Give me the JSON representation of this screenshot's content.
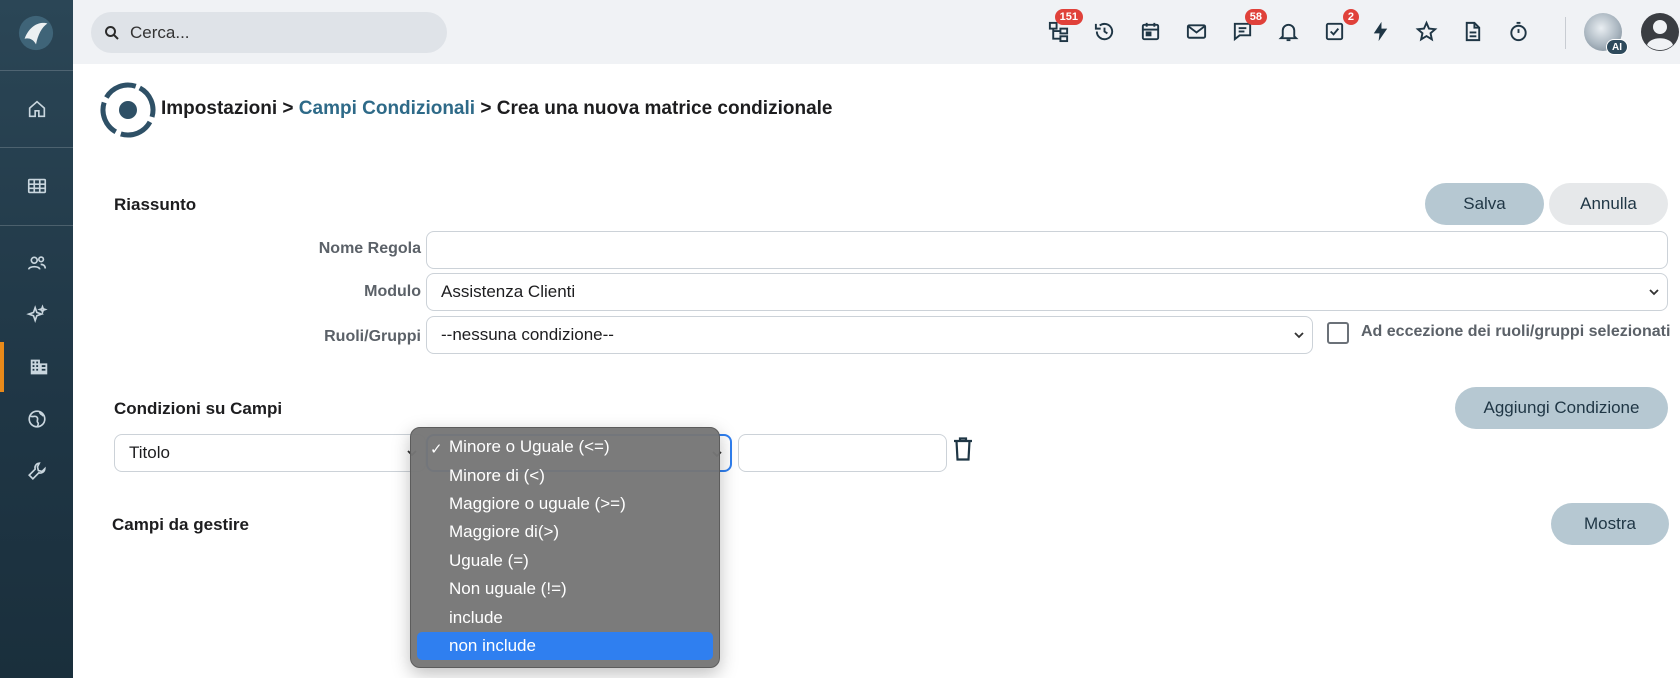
{
  "search": {
    "placeholder": "Cerca..."
  },
  "topbar": {
    "badges": {
      "hierarchy": "151",
      "chat": "58",
      "tasks": "2"
    },
    "avatar_badge": "AI"
  },
  "breadcrumb": {
    "root": "Impostazioni",
    "sep1": " > ",
    "link": "Campi Condizionali",
    "sep2": " > ",
    "current": "Crea una nuova matrice condizionale"
  },
  "summary": {
    "title": "Riassunto",
    "save_label": "Salva",
    "cancel_label": "Annulla",
    "rule_name_label": "Nome Regola",
    "rule_name_value": "",
    "module_label": "Modulo",
    "module_value": "Assistenza Clienti",
    "roles_label": "Ruoli/Gruppi",
    "roles_value": "--nessuna condizione--",
    "except_label": "Ad eccezione dei ruoli/gruppi selezionati"
  },
  "conditions": {
    "title": "Condizioni su Campi",
    "add_label": "Aggiungi Condizione",
    "field_value": "Titolo",
    "value_input": ""
  },
  "manage": {
    "title": "Campi da gestire",
    "show_label": "Mostra"
  },
  "operator_dropdown": {
    "checked": "Minore o Uguale (<=)",
    "highlighted": "non include",
    "options": [
      "Minore o Uguale (<=)",
      "Minore di (<)",
      "Maggiore o uguale (>=)",
      "Maggiore di(>)",
      "Uguale (=)",
      "Non uguale (!=)",
      "include",
      "non include"
    ]
  },
  "colors": {
    "sidebar": "#1f3645",
    "accent_active": "#e88a1a",
    "primary_button": "#b6c8d2",
    "link": "#2e6a88",
    "badge": "#e0413a",
    "dropdown_highlight": "#2f7ff0"
  }
}
